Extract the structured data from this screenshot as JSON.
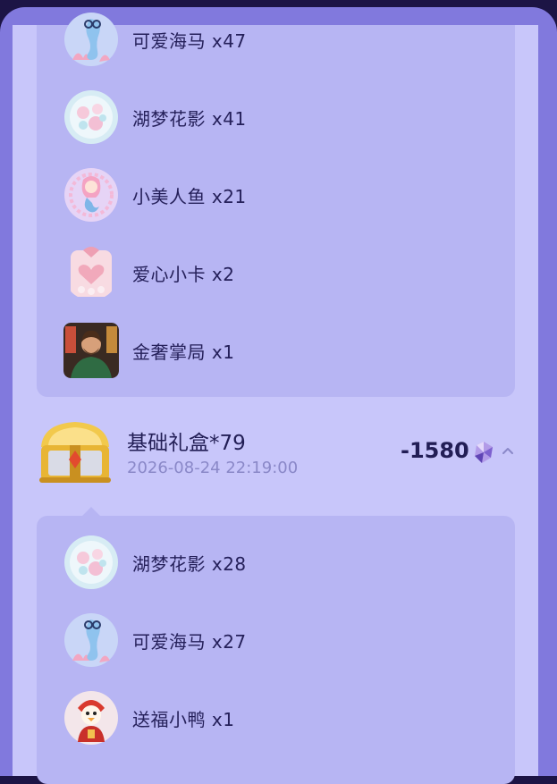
{
  "group_one": {
    "items": [
      {
        "label": "可爱海马 x47",
        "icon": "seahorse-icon"
      },
      {
        "label": "湖梦花影 x41",
        "icon": "flower-orb-icon"
      },
      {
        "label": "小美人鱼 x21",
        "icon": "mermaid-icon"
      },
      {
        "label": "爱心小卡 x2",
        "icon": "heart-card-icon"
      },
      {
        "label": "金奢掌局 x1",
        "icon": "gentleman-portrait-icon"
      }
    ]
  },
  "box": {
    "title": "基础礼盒*79",
    "time": "2026-08-24 22:19:00",
    "amount": "-1580",
    "icon": "treasure-chest-icon",
    "currency_icon": "crystal-gem-icon",
    "toggle_icon": "chevron-up-icon"
  },
  "group_two": {
    "items": [
      {
        "label": "湖梦花影 x28",
        "icon": "flower-orb-icon"
      },
      {
        "label": "可爱海马 x27",
        "icon": "seahorse-icon"
      },
      {
        "label": "送福小鸭 x1",
        "icon": "lucky-duck-icon"
      }
    ]
  },
  "colors": {
    "frame": "#8179dd",
    "panel": "#c8c6fa",
    "group": "#b7b5f3",
    "text": "#25205a",
    "muted": "#8a88c8"
  }
}
